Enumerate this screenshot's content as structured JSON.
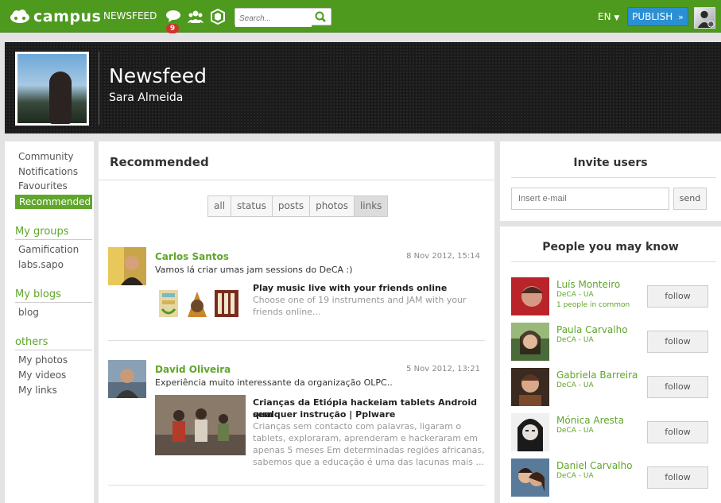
{
  "topbar": {
    "logo_text": "campus",
    "newsfeed_label": "NEWSFEED",
    "notification_count": "9",
    "search_placeholder": "Search...",
    "lang_label": "EN",
    "publish_label": "PUBLISH",
    "colors": {
      "bar": "#4e9a1e",
      "publish": "#2b8fd4",
      "badge": "#d0342c"
    }
  },
  "hero": {
    "title": "Newsfeed",
    "subtitle": "Sara Almeida"
  },
  "sidebar": {
    "items": [
      "Community",
      "Notifications",
      "Favourites"
    ],
    "active": "Recommended",
    "groups_head": "My groups",
    "groups": [
      "Gamification",
      "labs.sapo"
    ],
    "blogs_head": "My blogs",
    "blogs": [
      "blog"
    ],
    "others_head": "others",
    "others": [
      "My photos",
      "My videos",
      "My links"
    ]
  },
  "main": {
    "title": "Recommended",
    "filters": [
      "all",
      "status",
      "posts",
      "photos",
      "links"
    ],
    "selected_filter": "links",
    "posts": [
      {
        "author": "Carlos Santos",
        "date": "8 Nov 2012, 15:14",
        "text": "Vamos lá criar umas jam sessions do DeCA :)",
        "link_title": "Play music live with your friends online",
        "link_desc_1": "Choose one of 19 instruments and JAM with your",
        "link_desc_2": "friends online..."
      },
      {
        "author": "David Oliveira",
        "date": "5 Nov 2012, 13:21",
        "text": "Experiência muito interessante da organização OLPC..",
        "link_title_1": "Crianças da Etiópia hackeiam tablets Android sem",
        "link_title_2": "qualquer instrução | Pplware",
        "link_desc_1": "Crianças sem contacto com palavras, ligaram o",
        "link_desc_2": "tablets, exploraram, aprenderam e hackeraram em",
        "link_desc_3": "apenas 5 meses Em determinadas regiões africanas,",
        "link_desc_4": "sabemos que a educação é uma das lacunas mais ..."
      }
    ]
  },
  "invite": {
    "title": "Invite users",
    "email_placeholder": "Insert e-mail",
    "send_label": "send"
  },
  "people": {
    "title": "People you may know",
    "follow_label": "follow",
    "list": [
      {
        "name": "Luís Monteiro",
        "org": "DeCA - UA",
        "common": "1 people in common"
      },
      {
        "name": "Paula Carvalho",
        "org": "DeCA - UA",
        "common": ""
      },
      {
        "name": "Gabriela Barreira",
        "org": "DeCA - UA",
        "common": ""
      },
      {
        "name": "Mónica Aresta",
        "org": "DeCA - UA",
        "common": ""
      },
      {
        "name": "Daniel Carvalho",
        "org": "DeCA - UA",
        "common": ""
      }
    ]
  }
}
